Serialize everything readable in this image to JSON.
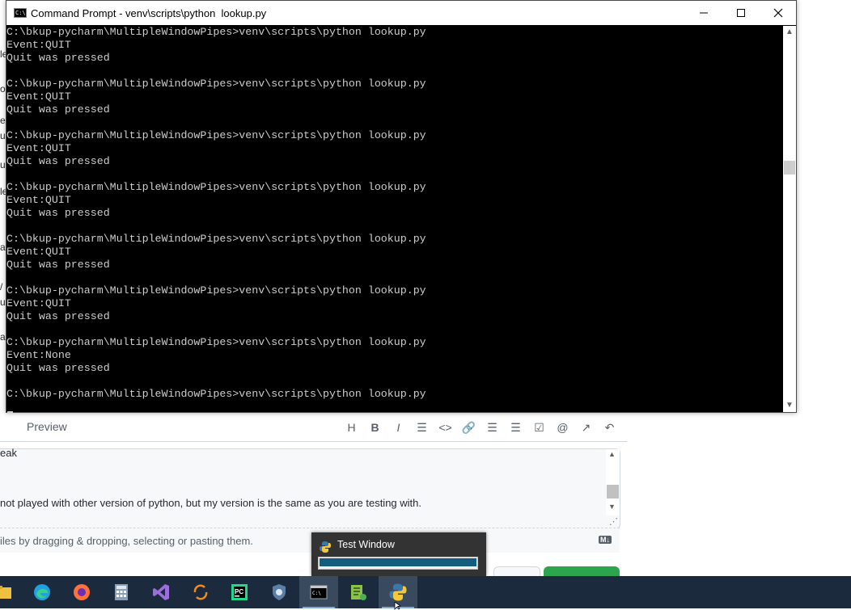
{
  "cmd": {
    "title": "Command Prompt - venv\\scripts\\python  lookup.py",
    "icon_label": "C:\\",
    "lines": [
      "C:\\bkup-pycharm\\MultipleWindowPipes>venv\\scripts\\python lookup.py",
      "Event:QUIT",
      "Quit was pressed",
      "",
      "C:\\bkup-pycharm\\MultipleWindowPipes>venv\\scripts\\python lookup.py",
      "Event:QUIT",
      "Quit was pressed",
      "",
      "C:\\bkup-pycharm\\MultipleWindowPipes>venv\\scripts\\python lookup.py",
      "Event:QUIT",
      "Quit was pressed",
      "",
      "C:\\bkup-pycharm\\MultipleWindowPipes>venv\\scripts\\python lookup.py",
      "Event:QUIT",
      "Quit was pressed",
      "",
      "C:\\bkup-pycharm\\MultipleWindowPipes>venv\\scripts\\python lookup.py",
      "Event:QUIT",
      "Quit was pressed",
      "",
      "C:\\bkup-pycharm\\MultipleWindowPipes>venv\\scripts\\python lookup.py",
      "Event:QUIT",
      "Quit was pressed",
      "",
      "C:\\bkup-pycharm\\MultipleWindowPipes>venv\\scripts\\python lookup.py",
      "Event:None",
      "Quit was pressed",
      "",
      "C:\\bkup-pycharm\\MultipleWindowPipes>venv\\scripts\\python lookup.py"
    ],
    "controls": {
      "minimize": "—",
      "maximize": "☐",
      "close": "✕"
    },
    "colors": {
      "background": "#000000",
      "text": "#cccccc"
    }
  },
  "editor": {
    "left_fragments": [
      "le",
      "ou",
      "e",
      "u",
      "ul",
      "le",
      "al",
      "/",
      "u",
      "ar"
    ],
    "preview_tab": "Preview",
    "toolbar_tools": [
      {
        "name": "heading-icon",
        "glyph": "H"
      },
      {
        "name": "bold-icon",
        "glyph": "B"
      },
      {
        "name": "italic-icon",
        "glyph": "I"
      },
      {
        "name": "quote-icon",
        "glyph": "☰"
      },
      {
        "name": "code-icon",
        "glyph": "<>"
      },
      {
        "name": "link-icon",
        "glyph": "🔗"
      },
      {
        "name": "bulleted-list-icon",
        "glyph": "☰"
      },
      {
        "name": "numbered-list-icon",
        "glyph": "☰"
      },
      {
        "name": "task-list-icon",
        "glyph": "☑"
      },
      {
        "name": "mention-icon",
        "glyph": "@"
      },
      {
        "name": "cross-reference-icon",
        "glyph": "↗"
      },
      {
        "name": "reply-icon",
        "glyph": "↶"
      }
    ],
    "comment_line1": "eak",
    "comment_line2": "not played with other version of python, but my version is the same as you are testing with.",
    "attach_text": "iles by dragging & dropping, selecting or pasting them.",
    "md_badge": "M↓"
  },
  "thumbnail": {
    "title": "Test Window",
    "icon": "python-icon",
    "progress_fill_color": "#135e7f"
  },
  "taskbar": {
    "items": [
      {
        "name": "file-explorer-icon",
        "active": false
      },
      {
        "name": "edge-icon",
        "active": false
      },
      {
        "name": "firefox-icon",
        "active": false
      },
      {
        "name": "calculator-icon",
        "active": false
      },
      {
        "name": "visual-studio-icon",
        "active": false
      },
      {
        "name": "sync-app-icon",
        "active": false
      },
      {
        "name": "pycharm-icon",
        "active": false
      },
      {
        "name": "shield-icon",
        "active": false
      },
      {
        "name": "command-prompt-icon",
        "active": true
      },
      {
        "name": "notepad-plus-plus-icon",
        "active": false
      },
      {
        "name": "python-icon",
        "active": true
      }
    ],
    "pycharm_label": "PC",
    "background": "#1c2a3d"
  }
}
